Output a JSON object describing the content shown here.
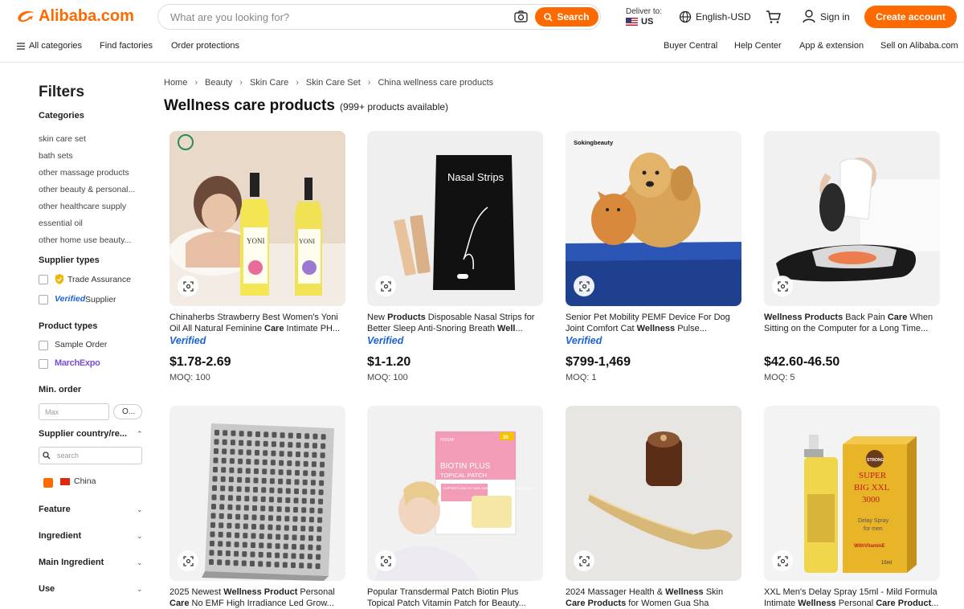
{
  "header": {
    "logo_text": "Alibaba.com",
    "search_placeholder": "What are you looking for?",
    "search_button": "Search",
    "deliver_label": "Deliver to:",
    "deliver_country": "US",
    "language": "English-USD",
    "sign_in": "Sign in",
    "create_account": "Create account"
  },
  "nav": {
    "left": [
      "All categories",
      "Find factories",
      "Order protections"
    ],
    "right": [
      "Buyer Central",
      "Help Center",
      "App & extension",
      "Sell on Alibaba.com"
    ]
  },
  "filters": {
    "title": "Filters",
    "categories_title": "Categories",
    "categories": [
      "skin care set",
      "bath sets",
      "other massage products",
      "other beauty & personal...",
      "other healthcare supply",
      "essential oil",
      "other home use beauty..."
    ],
    "supplier_types_title": "Supplier types",
    "supplier_types": [
      "Trade Assurance",
      "Supplier"
    ],
    "verified_word": "Verified",
    "product_types_title": "Product types",
    "product_types": [
      "Sample Order",
      "MarchExpo"
    ],
    "min_order_title": "Min. order",
    "min_order_placeholder": "Max",
    "min_order_ok": "O...",
    "supplier_country_title": "Supplier country/re...",
    "country_search_placeholder": "search",
    "country_selected": "China",
    "collapsed": [
      "Feature",
      "Ingredient",
      "Main Ingredient",
      "Use"
    ]
  },
  "breadcrumb": [
    "Home",
    "Beauty",
    "Skin Care",
    "Skin Care Set",
    "China wellness care products"
  ],
  "page": {
    "title": "Wellness care products",
    "count": "(999+ products available)"
  },
  "products": [
    {
      "title_html": "Chinaherbs Strawberry Best Women's Yoni Oil All Natural Feminine <b>Care</b> Intimate PH...",
      "verified": "Verified",
      "price": "$1.78-2.69",
      "moq": "MOQ: 100",
      "image": "yoni-oil-bottles",
      "img_label": "YONI",
      "brand_label": "Chinaherbs"
    },
    {
      "title_html": "New <b>Products</b> Disposable Nasal Strips for Better Sleep Anti-Snoring Breath <b>Well</b>...",
      "verified": "Verified",
      "price": "$1-1.20",
      "moq": "MOQ: 100",
      "image": "nasal-strips-pack",
      "img_label": "Nasal Strips"
    },
    {
      "title_html": "Senior Pet Mobility PEMF Device For Dog Joint Comfort Cat <b>Wellness</b> Pulse...",
      "verified": "Verified",
      "price": "$799-1,469",
      "moq": "MOQ: 1",
      "image": "dog-and-cat-on-bed",
      "img_label": "Sokingbeauty"
    },
    {
      "title_html": "<b>Wellness Products</b> Back Pain <b>Care</b> When Sitting on the Computer for a Long Time...",
      "verified": "",
      "price": "$42.60-46.50",
      "moq": "MOQ: 5",
      "image": "back-massager-device"
    },
    {
      "title_html": "2025 Newest <b>Wellness Product</b> Personal <b>Care</b> No EMF High Irradiance Led Grow...",
      "verified": "",
      "price": "",
      "moq": "",
      "image": "led-panel"
    },
    {
      "title_html": "Popular Transdermal Patch Biotin Plus Topical Patch Vitamin Patch for Beauty...",
      "verified": "",
      "price": "",
      "moq": "",
      "image": "biotin-patch",
      "img_label": "BIOTIN PLUS",
      "img_label2": "TOPICAL PATCH",
      "img_label3": "SUPPORTS HEALTHY HAIR, SKIN, NAILS & ENERGY PRODUCTION",
      "img_brand": "HOOAF",
      "img_count": "30"
    },
    {
      "title_html": "2024 Massager Health &amp; <b>Wellness</b> Skin <b>Care Products</b> for Women Gua Sha Massage To...",
      "verified": "",
      "price": "",
      "moq": "",
      "image": "gua-sha-tool"
    },
    {
      "title_html": "XXL Men's Delay Spray 15ml - Mild Formula Intimate <b>Wellness</b> Personal <b>Care Product</b>...",
      "verified": "",
      "price": "",
      "moq": "",
      "image": "spray-bottle-box",
      "img_label": "SUPER",
      "img_label2": "BIG XXL",
      "img_label3": "3000",
      "img_label4": "Delay Spray",
      "img_label5": "for men",
      "img_label6": "WithVitaminE",
      "img_label7": "15ml",
      "img_brand": "STRONG"
    }
  ],
  "colors": {
    "accent": "#ff6a00",
    "verified": "#1a62d8"
  }
}
